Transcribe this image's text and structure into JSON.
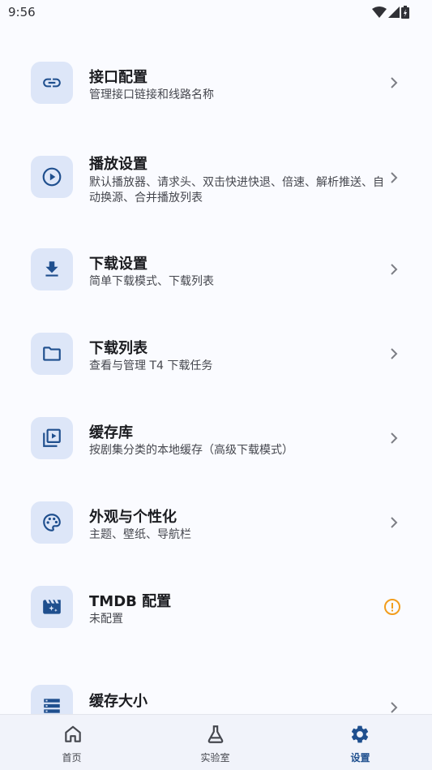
{
  "status_bar": {
    "time": "9:56"
  },
  "settings": [
    {
      "title": "接口配置",
      "subtitle": "管理接口链接和线路名称",
      "icon": "link-icon",
      "trailing": "chevron"
    },
    {
      "title": "播放设置",
      "subtitle": "默认播放器、请求头、双击快进快退、倍速、解析推送、自动换源、合并播放列表",
      "icon": "play-circle-icon",
      "trailing": "chevron"
    },
    {
      "title": "下载设置",
      "subtitle": "简单下载模式、下载列表",
      "icon": "download-icon",
      "trailing": "chevron"
    },
    {
      "title": "下载列表",
      "subtitle": "查看与管理 T4 下载任务",
      "icon": "folder-icon",
      "trailing": "chevron"
    },
    {
      "title": "缓存库",
      "subtitle": "按剧集分类的本地缓存（高级下载模式）",
      "icon": "video-library-icon",
      "trailing": "chevron"
    },
    {
      "title": "外观与个性化",
      "subtitle": "主题、壁纸、导航栏",
      "icon": "palette-icon",
      "trailing": "chevron"
    },
    {
      "title": "TMDB 配置",
      "subtitle": "未配置",
      "icon": "movie-filter-icon",
      "trailing": "warning"
    },
    {
      "title": "缓存大小",
      "subtitle": "",
      "icon": "storage-icon",
      "trailing": "chevron"
    }
  ],
  "bottom_nav": {
    "items": [
      {
        "label": "首页",
        "icon": "home-icon",
        "active": false
      },
      {
        "label": "实验室",
        "icon": "flask-icon",
        "active": false
      },
      {
        "label": "设置",
        "icon": "gear-icon",
        "active": true
      }
    ]
  },
  "colors": {
    "accent": "#1f4f8e",
    "icon_box_bg": "#dde6f8",
    "warning": "#f29d1d",
    "background": "#fafbff"
  }
}
